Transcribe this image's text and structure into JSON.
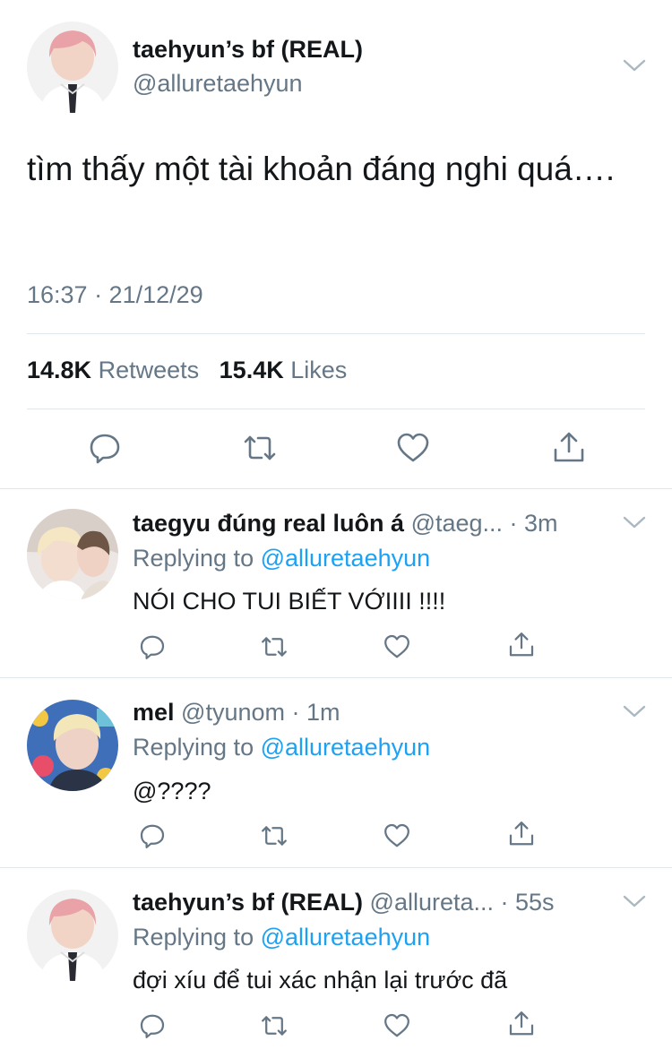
{
  "main_tweet": {
    "display_name": "taehyun’s bf (REAL)",
    "handle": "@alluretaehyun",
    "text": "tìm thấy một tài khoản đáng nghi quá….",
    "timestamp": "16:37 · 21/12/29",
    "retweets_count": "14.8K",
    "retweets_label": "Retweets",
    "likes_count": "15.4K",
    "likes_label": "Likes"
  },
  "replies": [
    {
      "display_name": "taegyu đúng real luôn á",
      "handle": "@taeg...",
      "time": "· 3m",
      "replying_prefix": "Replying to",
      "replying_to": "@alluretaehyun",
      "text": "NÓI CHO TUI BIẾT VỚIIII !!!!"
    },
    {
      "display_name": "mel",
      "handle": "@tyunom",
      "time": "· 1m",
      "replying_prefix": "Replying to",
      "replying_to": "@alluretaehyun",
      "text": "@????"
    },
    {
      "display_name": "taehyun’s bf (REAL)",
      "handle": "@allureta...",
      "time": "· 55s",
      "replying_prefix": "Replying to",
      "replying_to": "@alluretaehyun",
      "text": "đợi xíu để tui xác nhận lại trước đã"
    }
  ],
  "icons": {
    "reply": "reply-bubble-icon",
    "retweet": "retweet-arrows-icon",
    "like": "heart-icon",
    "share": "share-upload-icon",
    "menu": "chevron-down-icon"
  },
  "colors": {
    "text": "#14171a",
    "muted": "#657786",
    "link": "#1da1f2",
    "divider": "#e1e8ed"
  }
}
